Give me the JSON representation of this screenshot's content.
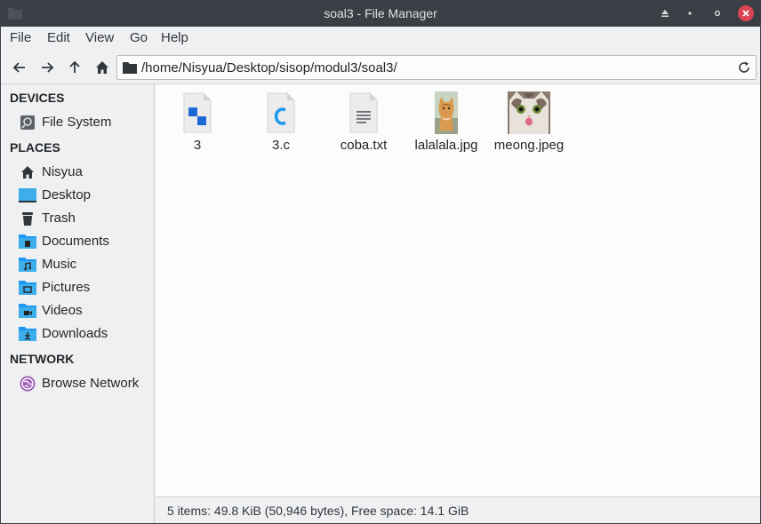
{
  "window": {
    "title": "soal3 - File Manager"
  },
  "menu": [
    "File",
    "Edit",
    "View",
    "Go",
    "Help"
  ],
  "location": {
    "path": "/home/Nisyua/Desktop/sisop/modul3/soal3/"
  },
  "sidebar": {
    "devices_header": "DEVICES",
    "devices": [
      {
        "label": "File System",
        "icon": "drive-icon"
      }
    ],
    "places_header": "PLACES",
    "places": [
      {
        "label": "Nisyua",
        "icon": "home-icon"
      },
      {
        "label": "Desktop",
        "icon": "desktop-icon"
      },
      {
        "label": "Trash",
        "icon": "trash-icon"
      },
      {
        "label": "Documents",
        "icon": "documents-folder-icon"
      },
      {
        "label": "Music",
        "icon": "music-folder-icon"
      },
      {
        "label": "Pictures",
        "icon": "pictures-folder-icon"
      },
      {
        "label": "Videos",
        "icon": "videos-folder-icon"
      },
      {
        "label": "Downloads",
        "icon": "downloads-folder-icon"
      }
    ],
    "network_header": "NETWORK",
    "network": [
      {
        "label": "Browse Network",
        "icon": "network-icon"
      }
    ]
  },
  "files": [
    {
      "name": "3",
      "icon": "executable-file-icon"
    },
    {
      "name": "3.c",
      "icon": "c-source-file-icon"
    },
    {
      "name": "coba.txt",
      "icon": "text-file-icon"
    },
    {
      "name": "lalalala.jpg",
      "icon": "image-thumbnail-cat"
    },
    {
      "name": "meong.jpeg",
      "icon": "image-thumbnail-cat-face"
    }
  ],
  "status": {
    "text": "5 items: 49.8 KiB (50,946 bytes), Free space: 14.1 GiB"
  },
  "colors": {
    "accent": "#3daee9",
    "titlebar": "#3a3f45",
    "close": "#da4453"
  }
}
